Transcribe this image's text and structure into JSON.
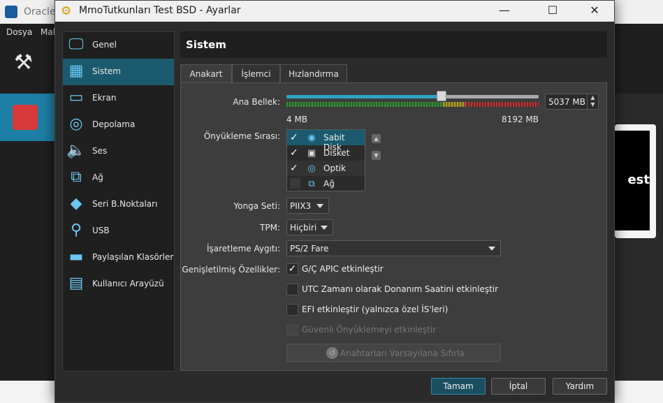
{
  "background": {
    "title": "Oracle",
    "menu": [
      "Dosya",
      "Mak"
    ],
    "preview_text": "est"
  },
  "dialog": {
    "title": "MmoTutkunları Test BSD - Ayarlar",
    "controls": {
      "minimize": "—",
      "maximize": "☐",
      "close": "✕"
    }
  },
  "sidebar": {
    "items": [
      {
        "label": "Genel",
        "icon": "monitor-icon"
      },
      {
        "label": "Sistem",
        "icon": "chip-icon",
        "active": true
      },
      {
        "label": "Ekran",
        "icon": "display-icon"
      },
      {
        "label": "Depolama",
        "icon": "disk-icon"
      },
      {
        "label": "Ses",
        "icon": "speaker-icon"
      },
      {
        "label": "Ağ",
        "icon": "network-icon"
      },
      {
        "label": "Seri B.Noktaları",
        "icon": "serial-port-icon"
      },
      {
        "label": "USB",
        "icon": "usb-icon"
      },
      {
        "label": "Paylaşılan Klasörler",
        "icon": "folder-icon"
      },
      {
        "label": "Kullanıcı Arayüzü",
        "icon": "ui-window-icon"
      }
    ]
  },
  "section_title": "Sistem",
  "tabs": [
    "Anakart",
    "İşlemci",
    "Hızlandırma"
  ],
  "motherboard": {
    "memory_label": "Ana Bellek:",
    "memory_min": "4 MB",
    "memory_max": "8192 MB",
    "memory_value": "5037 MB",
    "memory_fraction": 0.614,
    "boot_order_label": "Önyükleme Sırası:",
    "boot_items": [
      {
        "label": "Sabit Disk",
        "checked": true,
        "icon": "hard-disk-icon"
      },
      {
        "label": "Disket",
        "checked": true,
        "icon": "floppy-icon"
      },
      {
        "label": "Optik",
        "checked": true,
        "icon": "optical-disc-icon"
      },
      {
        "label": "Ağ",
        "checked": false,
        "icon": "network-icon"
      }
    ],
    "chipset_label": "Yonga Seti:",
    "chipset_value": "PIIX3",
    "tpm_label": "TPM:",
    "tpm_value": "Hiçbiri",
    "pointing_label": "İşaretleme Aygıtı:",
    "pointing_value": "PS/2 Fare",
    "extended_label": "Genişletilmiş Özellikler:",
    "features": [
      {
        "label": "G/Ç APIC etkinleştir",
        "checked": true,
        "disabled": false
      },
      {
        "label": "UTC Zamanı olarak Donanım Saatini etkinleştir",
        "checked": false,
        "disabled": false
      },
      {
        "label": "EFI etkinleştir (yalnızca özel İS'leri)",
        "checked": false,
        "disabled": false
      },
      {
        "label": "Güvenli Önyüklemeyi etkinleştir",
        "checked": false,
        "disabled": true
      }
    ],
    "reset_keys_label": "Anahtarları Varsayılana Sıfırla"
  },
  "buttons": {
    "ok": "Tamam",
    "cancel": "İptal",
    "help": "Yardım"
  },
  "colors": {
    "accent": "#1b5a6e",
    "slider": "#2ea2c7"
  }
}
